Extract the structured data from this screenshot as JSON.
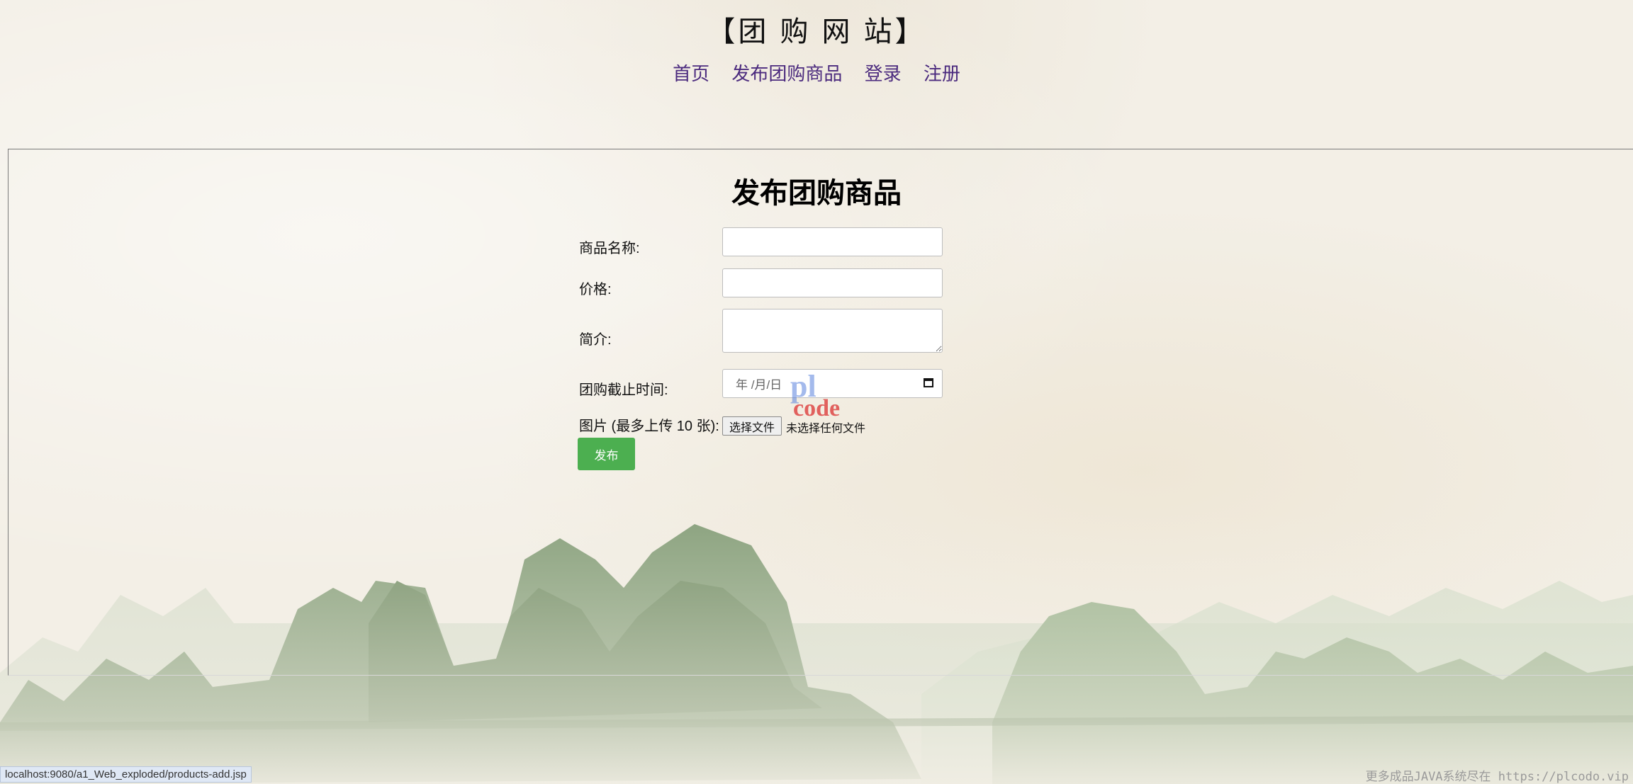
{
  "site_title": "【团 购 网 站】",
  "nav": [
    "首页",
    "发布团购商品",
    "登录",
    "注册"
  ],
  "form": {
    "title": "发布团购商品",
    "name_label": "商品名称:",
    "price_label": "价格:",
    "desc_label": "简介:",
    "deadline_label": "团购截止时间:",
    "deadline_placeholder": "年 /月/日",
    "image_label": "图片 (最多上传 10 张):",
    "file_button": "选择文件",
    "file_none": "未选择任何文件",
    "submit": "发布"
  },
  "watermark": {
    "pl": "pl",
    "code": "code"
  },
  "status_bar": "localhost:9080/a1_Web_exploded/products-add.jsp",
  "footer_watermark": "更多成品JAVA系统尽在 https://plcodo.vip",
  "colors": {
    "nav_link": "#4b2a7e",
    "submit_bg": "#4caf50",
    "mountains": "#8aa77c"
  }
}
